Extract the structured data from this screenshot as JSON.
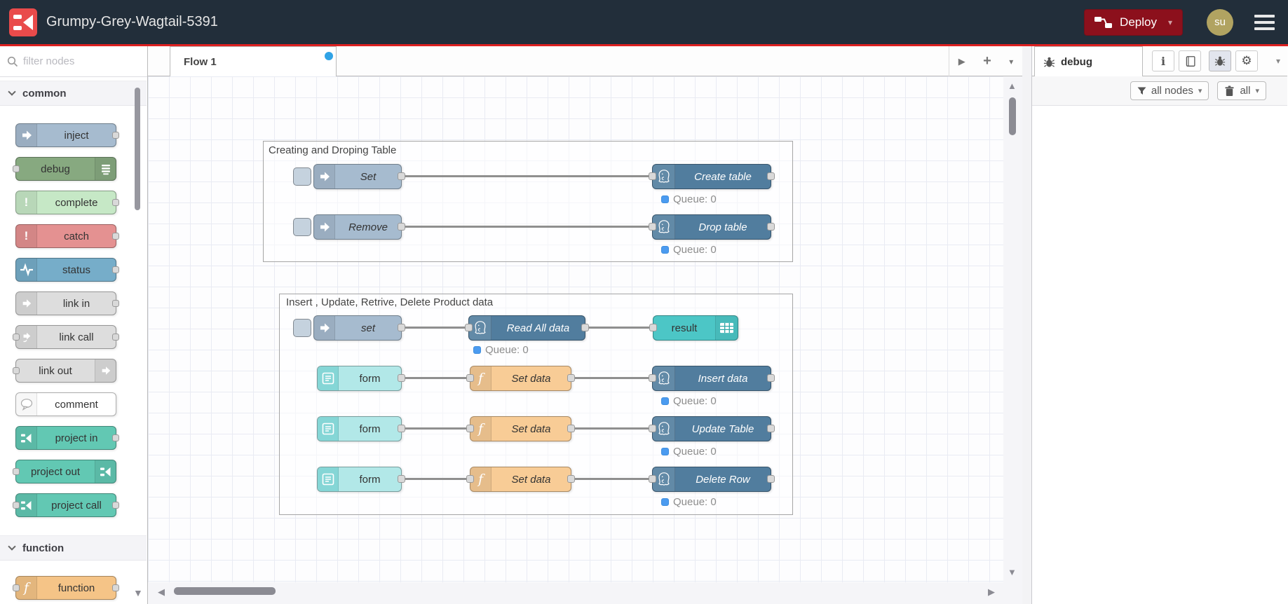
{
  "header": {
    "title": "Grumpy-Grey-Wagtail-5391",
    "deploy": "Deploy",
    "avatar": "su"
  },
  "palette": {
    "filter_placeholder": "filter nodes",
    "cat_common": "common",
    "cat_function": "function",
    "nodes": {
      "inject": "inject",
      "debug": "debug",
      "complete": "complete",
      "catch": "catch",
      "status": "status",
      "link_in": "link in",
      "link_call": "link call",
      "link_out": "link out",
      "comment": "comment",
      "project_in": "project in",
      "project_out": "project out",
      "project_call": "project call",
      "function": "function"
    }
  },
  "workspace": {
    "tab": "Flow 1"
  },
  "flows": {
    "group1": {
      "label": "Creating and Droping Table",
      "row1": {
        "source": "Set",
        "target": "Create table",
        "status": "Queue: 0"
      },
      "row2": {
        "source": "Remove",
        "target": "Drop table",
        "status": "Queue: 0"
      }
    },
    "group2": {
      "label": "Insert , Update, Retrive, Delete Product data",
      "row1": {
        "source": "set",
        "middle": "Read All data",
        "target": "result",
        "status": "Queue: 0"
      },
      "row2": {
        "source": "form",
        "middle": "Set data",
        "target": "Insert data",
        "status": "Queue: 0"
      },
      "row3": {
        "source": "form",
        "middle": "Set data",
        "target": "Update Table",
        "status": "Queue: 0"
      },
      "row4": {
        "source": "form",
        "middle": "Set data",
        "target": "Delete Row",
        "status": "Queue: 0"
      }
    }
  },
  "sidebar": {
    "tab": "debug",
    "filter_button": "all nodes",
    "clear_button": "all"
  },
  "icons": {
    "plus": "+",
    "caret": "▾",
    "up": "▲",
    "down": "▼",
    "left": "◀",
    "right": "▶",
    "gear": "⚙",
    "info": "i",
    "function_f": "f",
    "exclaim": "!"
  },
  "colors": {
    "header_bg": "#222e3a",
    "accent_red": "#dd2020",
    "deploy_bg": "#8C101C",
    "logo_red": "#e94b4b",
    "tab_dot": "#30a3e6",
    "status_dot": "#4b9bf0",
    "inject": "#a6bbcf",
    "debug": "#87a980",
    "complete": "#c6e8c6",
    "catch": "#e49191",
    "status": "#76adc9",
    "link": "#dddddd",
    "comment": "#ffffff",
    "project": "#62c8b3",
    "function": "#f5c487",
    "postgres": "#517d9e",
    "form": "#b2e8e8",
    "result": "#4cc6c6"
  }
}
